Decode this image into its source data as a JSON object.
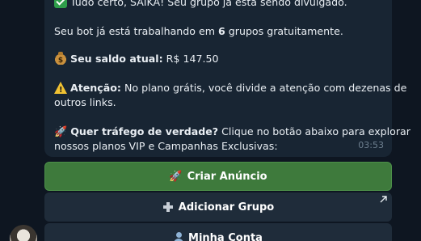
{
  "message": {
    "line1": "Tudo certo, SAIKA! Seu grupo já está sendo divulgado.",
    "line2_prefix": "Seu bot já está trabalhando em ",
    "line2_count": "6",
    "line2_suffix": " grupos gratuitamente.",
    "balance_label": "Seu saldo atual:",
    "balance_value": " R$ 147.50",
    "warning_label": "Atenção:",
    "warning_text_1": " No plano grátis, você divide a atenção com dezenas de",
    "warning_text_2": "outros links.",
    "cta_label": "Quer tráfego de verdade?",
    "cta_text_1": " Clique no botão abaixo para explorar",
    "cta_text_2": "nossos planos VIP e Campanhas Exclusivas:",
    "time": "03:53",
    "rocket_glyph": "🚀"
  },
  "buttons": {
    "create_ad": "Criar Anúncio",
    "add_group": "Adicionar Grupo",
    "my_account": "Minha Conta",
    "rocket_glyph": "🚀"
  },
  "colors": {
    "background": "#0e1621",
    "bubble": "#182533",
    "primary_button": "#3e7a3c",
    "secondary_button": "#1f2c3a"
  }
}
